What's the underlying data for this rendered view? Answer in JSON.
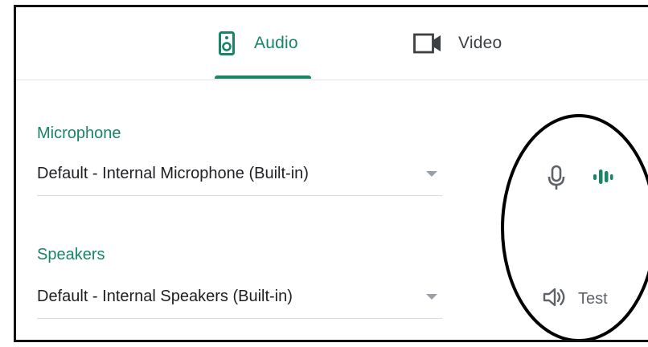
{
  "tabs": {
    "audio_label": "Audio",
    "video_label": "Video",
    "active": "audio"
  },
  "microphone": {
    "section_label": "Microphone",
    "selected_device": "Default - Internal Microphone (Built-in)"
  },
  "speakers": {
    "section_label": "Speakers",
    "selected_device": "Default - Internal Speakers (Built-in)",
    "test_label": "Test"
  },
  "icons": {
    "audio_tab": "speaker-device-icon",
    "video_tab": "video-camera-icon",
    "microphone": "microphone-icon",
    "mic_level": "audio-level-icon",
    "speaker_test": "volume-icon"
  },
  "colors": {
    "accent": "#188566",
    "text_primary": "#202124",
    "text_secondary": "#5f6368",
    "divider": "#dadce0",
    "annotation": "#000000"
  }
}
